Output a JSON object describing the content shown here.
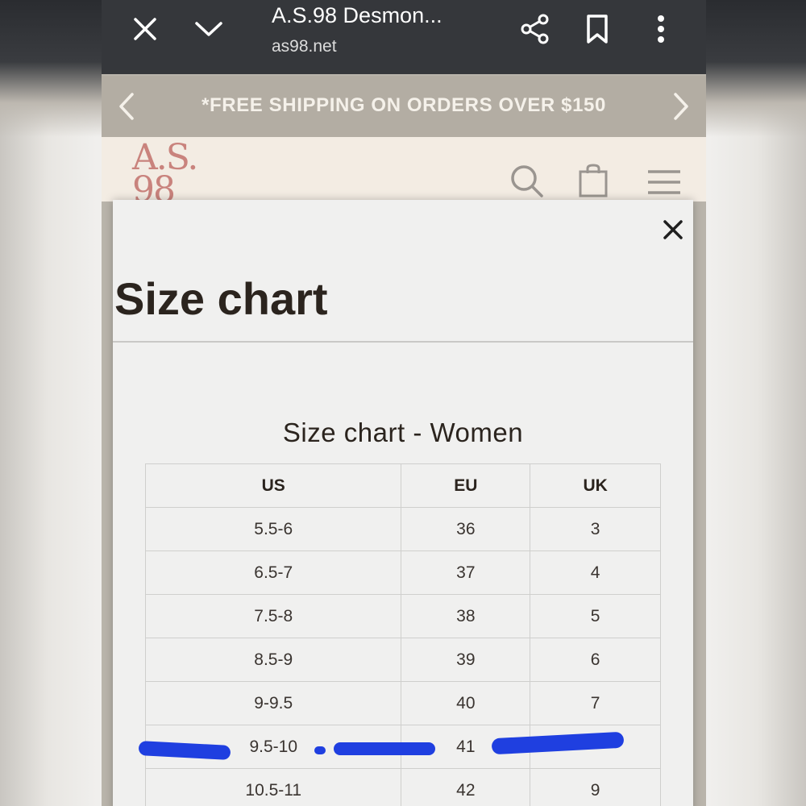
{
  "browser": {
    "title": "A.S.98 Desmon...",
    "url": "as98.net",
    "icons": [
      "close-icon",
      "chevron-down-icon",
      "share-icon",
      "bookmark-icon",
      "more-vert-icon"
    ]
  },
  "promo": {
    "text": "*FREE SHIPPING ON ORDERS OVER $150",
    "icons": [
      "chevron-left-icon",
      "chevron-right-icon"
    ]
  },
  "site_header": {
    "logo_line1": "A.S.",
    "logo_line2": "98",
    "icons": [
      "search-icon",
      "bag-icon",
      "menu-icon"
    ]
  },
  "modal": {
    "title": "Size chart",
    "chart_heading": "Size chart - Women",
    "table": {
      "headers": [
        "US",
        "EU",
        "UK"
      ],
      "rows": [
        [
          "5.5-6",
          "36",
          "3"
        ],
        [
          "6.5-7",
          "37",
          "4"
        ],
        [
          "7.5-8",
          "38",
          "5"
        ],
        [
          "8.5-9",
          "39",
          "6"
        ],
        [
          "9-9.5",
          "40",
          "7"
        ],
        [
          "9.5-10",
          "41",
          ""
        ],
        [
          "10.5-11",
          "42",
          "9"
        ]
      ]
    }
  },
  "colors": {
    "browser_bar": "#35373b",
    "promo_bar": "#b3ada3",
    "header_bg": "#f3ece3",
    "logo": "#c9837d",
    "modal_bg": "#f0f0ef",
    "marker": "#1f3fe0"
  }
}
